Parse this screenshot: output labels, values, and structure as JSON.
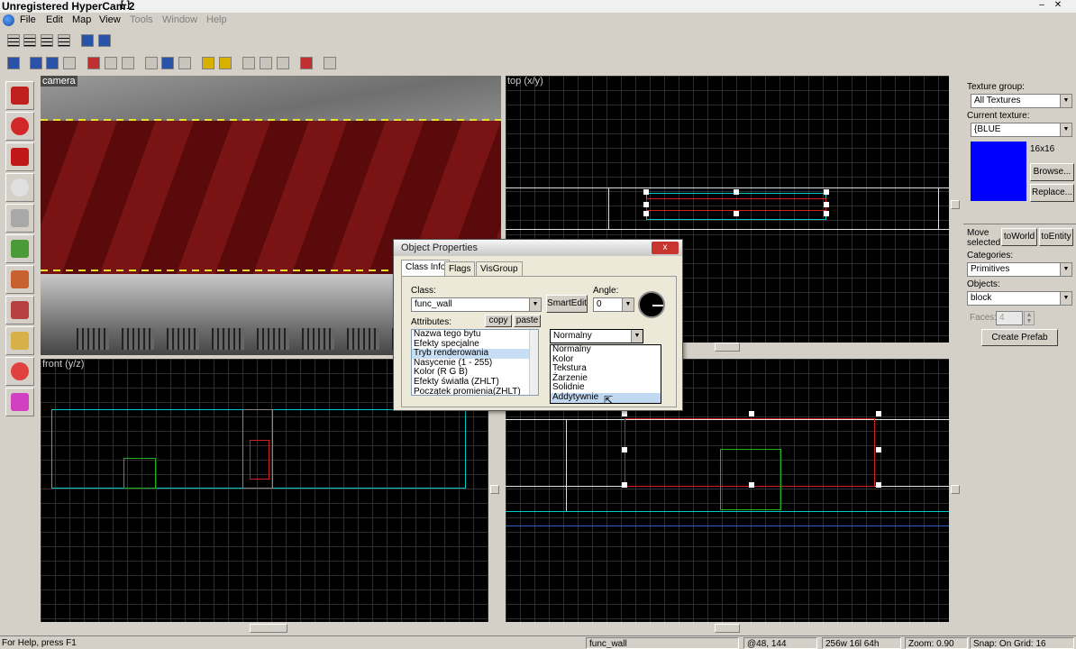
{
  "window": {
    "title": "Unregistered HyperCam 2",
    "title_extra": "[-]"
  },
  "menu": {
    "items": [
      "File",
      "Edit",
      "Map",
      "View",
      "Tools",
      "Window",
      "Help"
    ]
  },
  "viewports": {
    "camera": "camera",
    "top": "top (x/y)",
    "front": "front (y/z)",
    "side": ""
  },
  "right_panel": {
    "texture_group_label": "Texture group:",
    "texture_group_value": "All Textures",
    "current_texture_label": "Current texture:",
    "current_texture_value": "{BLUE",
    "texture_size": "16x16",
    "texture_color": "#0000ff",
    "browse_label": "Browse...",
    "replace_label": "Replace...",
    "move_selected_label": "Move selected:",
    "to_world_label": "toWorld",
    "to_entity_label": "toEntity",
    "categories_label": "Categories:",
    "categories_value": "Primitives",
    "objects_label": "Objects:",
    "objects_value": "block",
    "faces_label": "Faces:",
    "faces_value": "4",
    "create_prefab_label": "Create Prefab"
  },
  "dialog": {
    "title": "Object Properties",
    "close_label": "x",
    "tabs": [
      "Class Info",
      "Flags",
      "VisGroup"
    ],
    "class_label": "Class:",
    "class_value": "func_wall",
    "smartedit_label": "SmartEdit",
    "angle_label": "Angle:",
    "angle_value": "0",
    "attributes_label": "Attributes:",
    "copy_label": "copy",
    "paste_label": "paste",
    "attributes": [
      "Nazwa tego bytu",
      "Efekty specjalne",
      "Tryb renderowania",
      "Nasycenie (1 - 255)",
      "Kolor (R G B)",
      "Efekty światła (ZHLT)",
      "Początek promienia(ZHLT)"
    ],
    "selected_attribute_index": 2,
    "value_combo": "Normalny",
    "value_options": [
      "Normalny",
      "Kolor",
      "Tekstura",
      "Żarzenie",
      "Solidnie",
      "Addytywnie"
    ],
    "highlighted_option_index": 5
  },
  "status": {
    "help": "For Help, press F1",
    "object": "func_wall",
    "coords": "@48, 144",
    "size": "256w 16l 64h",
    "zoom": "Zoom: 0.90",
    "snap": "Snap: On Grid: 16"
  }
}
